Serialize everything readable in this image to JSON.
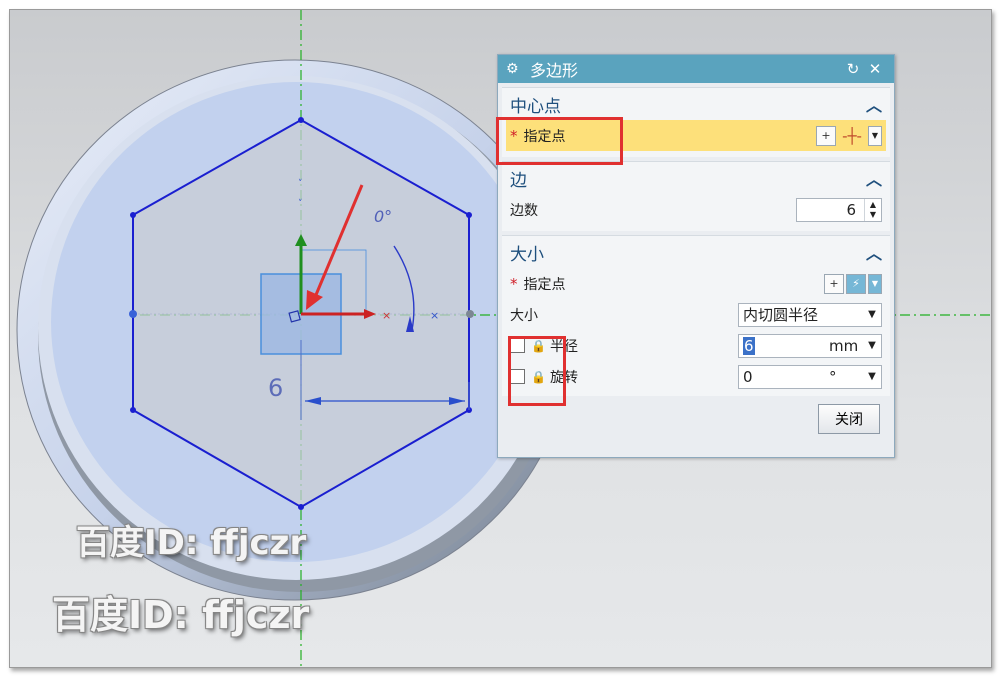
{
  "dialog": {
    "title": "多边形",
    "title_icon": "gear-icon",
    "reset_icon": "reset-icon",
    "close_icon": "close-icon",
    "sections": {
      "center": {
        "title": "中心点",
        "point_label": "指定点"
      },
      "sides": {
        "title": "边",
        "count_label": "边数",
        "count_value": "6"
      },
      "size": {
        "title": "大小",
        "point_label": "指定点",
        "size_label": "大小",
        "size_value": "内切圆半径",
        "radius_label": "半径",
        "radius_value": "6",
        "radius_unit": "mm",
        "rotation_label": "旋转",
        "rotation_value": "0",
        "rotation_unit": "°"
      }
    },
    "close_button": "关闭"
  },
  "canvas": {
    "dimension_text": "6",
    "angle_text": "0°"
  },
  "watermarks": [
    "百度ID: ffjczr",
    "百度ID: ffjczr"
  ],
  "colors": {
    "title_bar": "#5aa3be",
    "highlight": "#fde07a",
    "sketch_blue": "#1a1fd0",
    "annotation_red": "#e03030"
  }
}
